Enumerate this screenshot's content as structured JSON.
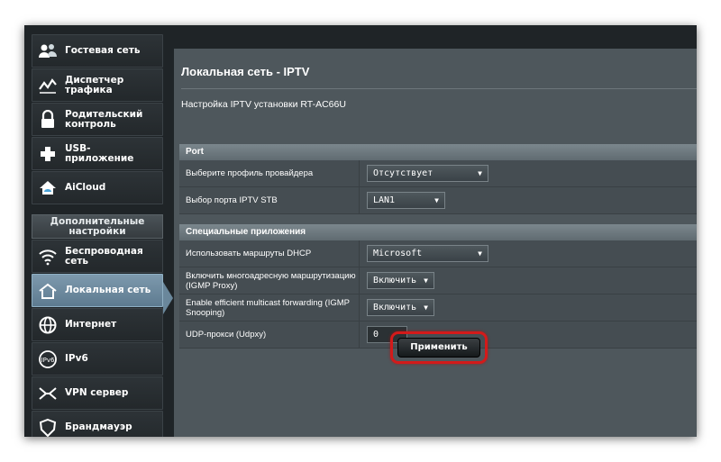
{
  "sidebar": {
    "items": [
      {
        "label": "Гостевая сеть",
        "icon": "guest-network-icon"
      },
      {
        "label": "Диспетчер трафика",
        "icon": "traffic-manager-icon"
      },
      {
        "label": "Родительский контроль",
        "icon": "parental-control-icon"
      },
      {
        "label": "USB-приложение",
        "icon": "usb-application-icon"
      },
      {
        "label": "AiCloud",
        "icon": "aicloud-icon"
      }
    ],
    "advanced_header": "Дополнительные настройки",
    "advanced_items": [
      {
        "label": "Беспроводная сеть",
        "icon": "wireless-icon"
      },
      {
        "label": "Локальная сеть",
        "icon": "lan-icon",
        "active": true
      },
      {
        "label": "Интернет",
        "icon": "internet-icon"
      },
      {
        "label": "IPv6",
        "icon": "ipv6-icon"
      },
      {
        "label": "VPN сервер",
        "icon": "vpn-icon"
      },
      {
        "label": "Брандмауэр",
        "icon": "firewall-icon"
      }
    ]
  },
  "main": {
    "title": "Локальная сеть - IPTV",
    "subtitle": "Настройка IPTV установки RT-AC66U",
    "port_section": {
      "header": "Port",
      "rows": [
        {
          "label": "Выберите профиль провайдера",
          "value": "Отсутствует"
        },
        {
          "label": "Выбор порта IPTV STB",
          "value": "LAN1"
        }
      ]
    },
    "special_section": {
      "header": "Специальные приложения",
      "rows": [
        {
          "label": "Использовать маршруты DHCP",
          "value": "Microsoft"
        },
        {
          "label": "Включить многоадресную маршрутизацию (IGMP Proxy)",
          "value": "Включить"
        },
        {
          "label": "Enable efficient multicast forwarding (IGMP Snooping)",
          "value": "Включить"
        },
        {
          "label": "UDP-прокси (Udpxy)",
          "value": "0"
        }
      ]
    },
    "apply_label": "Применить"
  },
  "colors": {
    "accent_active": "#6a879b",
    "highlight_red": "#d31a1a",
    "panel_bg": "#4e575c"
  }
}
